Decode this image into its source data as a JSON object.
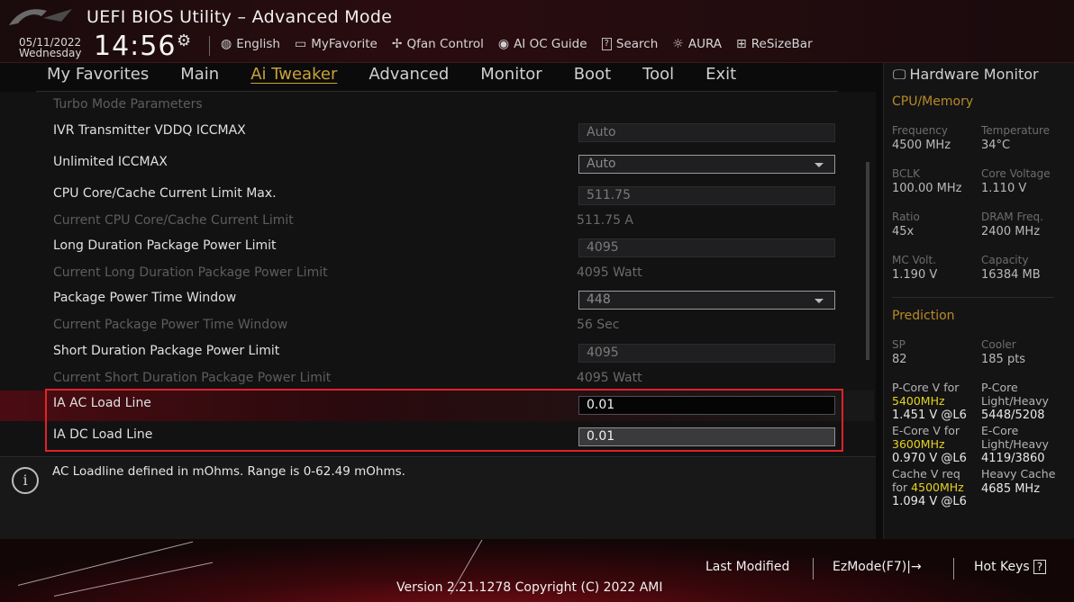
{
  "header": {
    "title": "UEFI BIOS Utility – Advanced Mode",
    "date": "05/11/2022",
    "day": "Wednesday",
    "time": "14:56",
    "toolbar": [
      {
        "icon": "globe-icon",
        "glyph": "🌐",
        "label": "English"
      },
      {
        "icon": "favorite-icon",
        "glyph": "▭",
        "label": "MyFavorite"
      },
      {
        "icon": "fan-icon",
        "glyph": "✢",
        "label": "Qfan Control"
      },
      {
        "icon": "ai-oc-icon",
        "glyph": "◉",
        "label": "AI OC Guide"
      },
      {
        "icon": "search-icon",
        "glyph": "?",
        "label": "Search"
      },
      {
        "icon": "aura-icon",
        "glyph": "☼",
        "label": "AURA"
      },
      {
        "icon": "resize-bar-icon",
        "glyph": "⊞",
        "label": "ReSizeBar"
      }
    ]
  },
  "nav": {
    "tabs": [
      "My Favorites",
      "Main",
      "Ai Tweaker",
      "Advanced",
      "Monitor",
      "Boot",
      "Tool",
      "Exit"
    ],
    "active": "Ai Tweaker"
  },
  "settings": {
    "section_title": "Turbo Mode Parameters",
    "rows": [
      {
        "label": "IVR Transmitter VDDQ ICCMAX",
        "value": "Auto"
      },
      {
        "label": "Unlimited ICCMAX",
        "value": "Auto"
      },
      {
        "label": "CPU Core/Cache Current Limit Max.",
        "value": "511.75"
      },
      {
        "label": "Current CPU Core/Cache Current Limit",
        "value": "511.75 A"
      },
      {
        "label": "Long Duration Package Power Limit",
        "value": "4095"
      },
      {
        "label": "Current Long Duration Package Power Limit",
        "value": "4095 Watt"
      },
      {
        "label": "Package Power Time Window",
        "value": "448"
      },
      {
        "label": "Current Package Power Time Window",
        "value": "56 Sec"
      },
      {
        "label": "Short Duration Package Power Limit",
        "value": "4095"
      },
      {
        "label": "Current Short Duration Package Power Limit",
        "value": "4095 Watt"
      },
      {
        "label": "IA AC Load Line",
        "value": "0.01"
      },
      {
        "label": "IA DC Load Line",
        "value": "0.01"
      }
    ]
  },
  "help": {
    "text": "AC Loadline defined in mOhms. Range is 0-62.49 mOhms."
  },
  "hardware_monitor": {
    "title": "Hardware Monitor",
    "cpu_memory": {
      "title": "CPU/Memory",
      "items": [
        {
          "label": "Frequency",
          "value": "4500 MHz"
        },
        {
          "label": "Temperature",
          "value": "34°C"
        },
        {
          "label": "BCLK",
          "value": "100.00 MHz"
        },
        {
          "label": "Core Voltage",
          "value": "1.110 V"
        },
        {
          "label": "Ratio",
          "value": "45x"
        },
        {
          "label": "DRAM Freq.",
          "value": "2400 MHz"
        },
        {
          "label": "MC Volt.",
          "value": "1.190 V"
        },
        {
          "label": "Capacity",
          "value": "16384 MB"
        }
      ]
    },
    "prediction": {
      "title": "Prediction",
      "sp_label": "SP",
      "sp_value": "82",
      "cooler_label": "Cooler",
      "cooler_value": "185 pts",
      "pcore_v_label": "P-Core V for",
      "pcore_freq": "5400MHz",
      "pcore_v_value": "1.451 V @L6",
      "pcore_lh_label_1": "P-Core",
      "pcore_lh_label_2": "Light/Heavy",
      "pcore_lh_value": "5448/5208",
      "ecore_v_label": "E-Core V for",
      "ecore_freq": "3600MHz",
      "ecore_v_value": "0.970 V @L6",
      "ecore_lh_label_1": "E-Core",
      "ecore_lh_label_2": "Light/Heavy",
      "ecore_lh_value": "4119/3860",
      "cache_v_label_1": "Cache V req",
      "cache_v_label_2": "for",
      "cache_freq": "4500MHz",
      "cache_v_value": "1.094 V @L6",
      "heavy_cache_label": "Heavy Cache",
      "heavy_cache_value": "4685 MHz"
    }
  },
  "footer": {
    "last_modified": "Last Modified",
    "ezmode": "EzMode(F7)|→",
    "hot_keys": "Hot Keys",
    "hot_keys_key": "?",
    "version": "Version 2.21.1278 Copyright (C) 2022 AMI"
  },
  "colors": {
    "accent_gold": "#c9a23a",
    "highlight_red": "#e0222a",
    "prediction_yellow": "#e6d21f"
  }
}
